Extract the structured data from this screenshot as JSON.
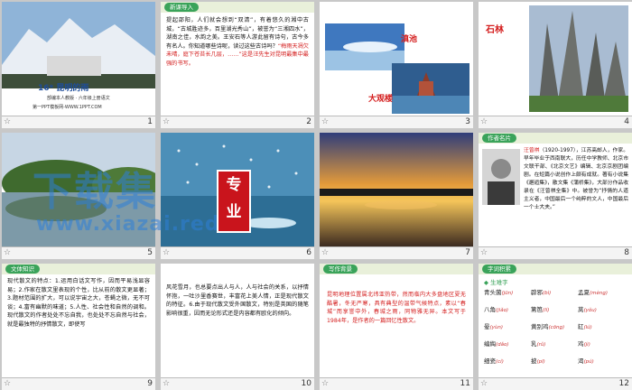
{
  "slides": [
    {
      "num": "1",
      "title": "16* 昆明的雨",
      "sub": "部编本人教版 · 六年级上册语文",
      "site": "第一PPT模板网-WWW.1PPT.COM"
    },
    {
      "num": "2",
      "tag": "新课导入",
      "text": "提起邵阳，人们就会想到“双清”，有着悠久的湘中古城，“古城胜迹多，百里湖光秀山”，被誉为“三湘四水”，湖南之佳，水韵之美。王安石等人游此留有诗句，古今多有名人。你知道哪些诗呢，读过这些古诗吗？",
      "red": "“梅雨天凋欠未晴，庭下苍苔长几层，……”这是汪先生对昆明最集中最强的书写。"
    },
    {
      "num": "3",
      "cap1": "滇池",
      "cap2": "大观楼"
    },
    {
      "num": "4",
      "cap1": "石林"
    },
    {
      "num": "5"
    },
    {
      "num": "6",
      "logo": "专业"
    },
    {
      "num": "7"
    },
    {
      "num": "8",
      "tag": "作者名片",
      "name": "汪曾祺",
      "text": "（1920-1997），江苏高邮人，作家。早年毕业于西南联大，历任中学教师、北京市文联干部、《北京文艺》编辑、北京京剧团编剧。在短篇小说创作上颇有成就。著有小说集《邂逅集》，散文集《蒲桥集》，大部分作品收录在《汪曾祺全集》中。被誉为“抒情的人道主义者，中国最后一个纯粹的文人，中国最后一个士大夫。”"
    },
    {
      "num": "9",
      "tag": "文体知识",
      "text": "现代散文的特点：1.运用白话文写作，因而平易浅显容易；2.作家在散文里表现的个性，比从前的散文更显著；3.题材范围的扩大，可以说宇宙之大，苍蝇之微，无不可谈；4.富有幽默的味道；5.人性、社会性和自然的调和。现代散文的作者处处不忘自我，也处处不忘自然与社会，就是最独特的抒情散文，即使写"
    },
    {
      "num": "10",
      "text": "风花雪月，也总要点出人与人，人与社会的关系，以抒情怀抱，一吐沙里香赛世，丰富花上美人情，正是现代散文的特征。6.由于现代散文受外国散文，特别是英国的随笔影响很重，因而无论形式还是内容都有欧化的倾向。"
    },
    {
      "num": "11",
      "tag": "写作背景",
      "text": "昆明地理位置属北纬亚热带，然而临内大多盘地区夏无酷暑，冬无严寒，具有典型的温带气候特点，素以“春城”而享誉中外，春城之雨，同物雅无异。本文写于1984年，是作者的一篇回忆性散文。"
    },
    {
      "num": "12",
      "tag": "字词积累",
      "sub": "◆ 生难字"
    }
  ],
  "ruby": [
    [
      [
        "青头菌",
        "jūn"
      ],
      [
        "辟邪",
        "bì"
      ],
      [
        "孟夏",
        "mèng"
      ]
    ],
    [
      [
        "八角",
        "jiǎo"
      ],
      [
        "篱笆",
        "lí"
      ],
      [
        "莴",
        "yǒu"
      ]
    ],
    [
      [
        "晕",
        "yùn"
      ],
      [
        "黄别鸡",
        "cōng"
      ],
      [
        "缸",
        "lú"
      ]
    ],
    [
      [
        "编綯",
        "dǎo"
      ],
      [
        "乳",
        "rǔ"
      ],
      [
        "鸡",
        "jì"
      ]
    ],
    [
      [
        "细瓷",
        "cí"
      ],
      [
        "披",
        "pī"
      ],
      [
        "渴",
        "pú"
      ]
    ]
  ],
  "watermark": {
    "main": "下载集",
    "url": "www.xiazai.red"
  },
  "footer_star": "☆",
  "colors": {
    "tag": "#3aa35a",
    "red": "#d41e1e",
    "watermark": "#2e7fd8"
  }
}
